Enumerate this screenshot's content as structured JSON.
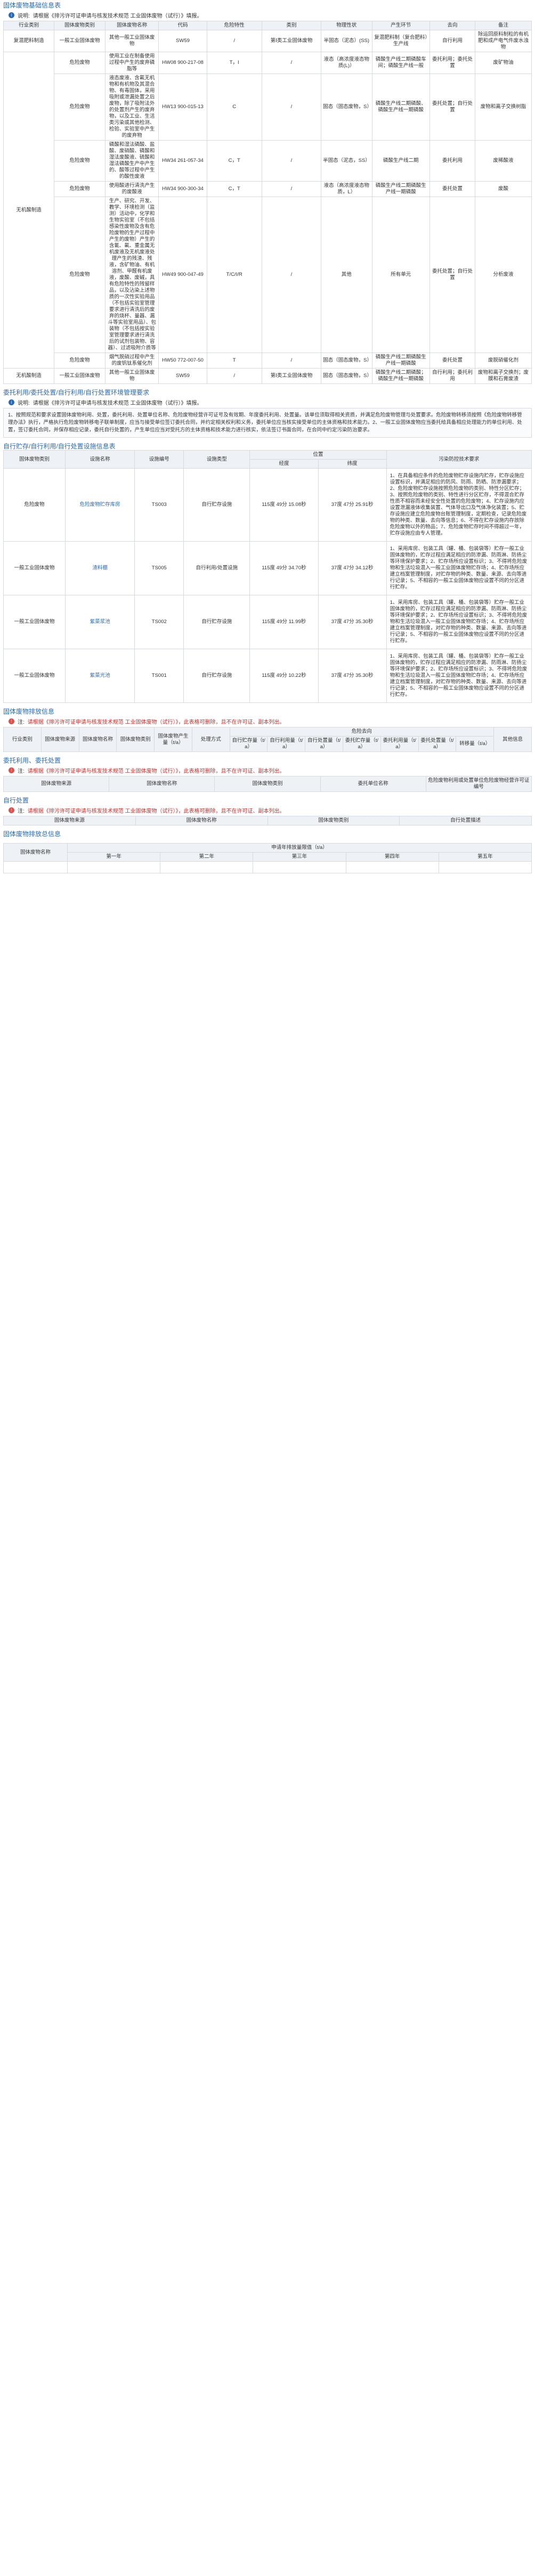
{
  "s1": {
    "title": "固体废物基础信息表",
    "note_label": "说明:",
    "note": "请根据《排污许可证申请与核发技术规范 工业固体废物（试行）》填报。",
    "headers": [
      "行业类别",
      "固体废物类别",
      "固体废物名称",
      "代码",
      "危险特性",
      "类别",
      "物理性状",
      "产生环节",
      "去向",
      "备注"
    ],
    "rows": [
      {
        "ind": "复混肥料制造",
        "type": "一般工业固体废物",
        "name": "其他一般工业固体废物",
        "code": "SW59",
        "hazard": "/",
        "cat": "第Ⅰ类工业固体废物",
        "phys": "半固态（泥态）(SS)",
        "stage": "复混肥料制（复合肥料）生产线",
        "dest": "自行利用",
        "remark": "除运回原料制粒的有机肥和成产电气件废水浊物"
      },
      {
        "ind": "",
        "type": "危险废物",
        "name": "使用工业在制备使用过程中产生的废弃磷脂等",
        "code": "HW08 900-217-08",
        "hazard": "T，I",
        "cat": "/",
        "phys": "液态（高浓度液态物质(L)）",
        "stage": "磷酸生产线二期磷酸车间；磷酸生产线一般",
        "dest": "委托利用；委托处置",
        "remark": "废矿物油"
      },
      {
        "ind": "",
        "type": "危险废物",
        "name": "液态废液、含氟无机物和有机物及其混合物、有毒固体，采用吸附或泄漏处置之后废物，除了吸附法外的处置剂产生的废弃物，以及工业、生活类污染或其他检测、检验、实验室中产生的废弃物",
        "code": "HW13 900-015-13",
        "hazard": "C",
        "cat": "/",
        "phys": "固态（固态废物，S）",
        "stage": "磷酸生产线二期磷酸、磷酸生产线一期磷酸",
        "dest": "委托处置；自行处置",
        "remark": "废物和离子交换树脂"
      },
      {
        "ind": "",
        "type": "危险废物",
        "name": "磷酸和湿法磷酸、盐酸、废硝酸、磷酸和湿法废酸液、硫酸和湿法磷酸生产中产生的、酸等过程中产生的酸性废液",
        "code": "HW34 261-057-34",
        "hazard": "C，T",
        "cat": "/",
        "phys": "半固态（泥态，SS）",
        "stage": "磷酸生产线二期",
        "dest": "委托利用",
        "remark": "废稀酸液"
      },
      {
        "ind": "",
        "type": "危险废物",
        "name": "使用酸进行清洗产生的废酸液",
        "code": "HW34 900-300-34",
        "hazard": "C，T",
        "cat": "/",
        "phys": "液态（高浓度液态物质，L）",
        "stage": "磷酸生产线二期磷酸生产线一期磷酸",
        "dest": "委托处置",
        "remark": "废酸"
      },
      {
        "ind": "无机酸制造",
        "type": "危险废物",
        "name": "生产、研究、开发、教学、环境检测（监测）活动中，化学和生物实验室（不包括感染性废物及含有危险废物的生产过程中产生的废物）产生的含氰、氟、重金属无机废液及无机废液处理产生的残渣、残液，含矿物油、有机溶剂、甲醛有机废液，废酸、废碱，具有危险特性的残留样品，以及沾染上述物质的一次性实验用品（不包括实验室管理要求进行清洗后的废弃的烧杯、量器、漏斗等实验室用品）、包装物（不包括按实验室管理要求进行清洗后的试剂包装物、容器）、过滤吸附介质等",
        "code": "HW49 900-047-49",
        "hazard": "T/C/I/R",
        "cat": "/",
        "phys": "其他",
        "stage": "所有单元",
        "dest": "委托处置；自行处置",
        "remark": "分析废液"
      },
      {
        "ind": "",
        "type": "危险废物",
        "name": "烟气脱硝过程中产生的废钒钛系催化剂",
        "code": "HW50 772-007-50",
        "hazard": "T",
        "cat": "/",
        "phys": "固态（固态废物，S）",
        "stage": "磷酸生产线二期磷酸生产线一期磷酸",
        "dest": "委托处置",
        "remark": "废脱硝催化剂"
      },
      {
        "ind": "无机酸制造",
        "type": "一般工业固体废物",
        "name": "其他一般工业固体废物",
        "code": "SW59",
        "hazard": "/",
        "cat": "第Ⅰ类工业固体废物",
        "phys": "固态（固态废物，S）",
        "stage": "磷酸生产线二期磷酸；磷酸生产线一期磷酸",
        "dest": "自行利用；委托利用",
        "remark": "废物和离子交换剂；废膜和石膏废渣"
      }
    ]
  },
  "s2": {
    "title": "委托利用/委托处置/自行利用/自行处置环境管理要求",
    "note_label": "说明:",
    "note": "请根据《排污许可证申请与核发技术规范 工业固体废物（试行）》填报。",
    "text": "1、按照规范和要求设置固体废物利用、处置，委托利用、处置单位名称、危险废物经营许可证号及有效期、年度委托利用、处置量。该单位须取得相关资质，并满足危险废物管理与处置要求。危险废物转移须按照《危险废物转移管理办法》执行，严格执行危险废物转移电子联单制度，应当与接受单位签订委托合同，并约定相关权利和义务，委托单位应当核实接受单位的主体资格和技术能力。2、一般工业固体废物应当委托给具备相应处理能力的单位利用、处置，签订委托合同，并保存相应记录，委托自行处置的，产生单位应当对受托方的主体资格和技术能力进行核实，依法签订书面合同，在合同中约定污染防治要求。"
  },
  "s3": {
    "title": "自行贮存/自行利用/自行处置设施信息表",
    "headers": [
      "固体废物类别",
      "设施名称",
      "设施编号",
      "设施类型",
      "位置",
      "经度",
      "纬度",
      "污染防控技术要求"
    ],
    "rows": [
      {
        "type": "危险废物",
        "name": "危险废物贮存库房",
        "no": "TS003",
        "kind": "自行贮存设施",
        "lng": "115度 49分 15.08秒",
        "lat": "37度 47分 25.91秒",
        "req": "1、在具备相应条件的危险废物贮存设施内贮存，贮存设施应设置标识，并满足相应的防风、防雨、防晒、防渗漏要求；2、危险废物贮存设施按照危险废物的类别、特性分区贮存；3、按照危险废物的类别、特性进行分区贮存，不得混合贮存性质不相容而未经安全性处置的危险废物；4、贮存设施内应设置泄漏液体收集装置、气体导出口及气体净化装置；5、贮存设施应建立危险废物台账管理制度，定期检查，记录危险废物的种类、数量、去向等信息；6、不得在贮存设施内存放除危险废物以外的物品；7、危险废物贮存时间不得超过一年，贮存设施应由专人管理。"
      },
      {
        "type": "一般工业固体废物",
        "name": "渣料棚",
        "no": "TS005",
        "kind": "自行利用/处置设施",
        "lng": "115度 49分 34.70秒",
        "lat": "37度 47分 34.12秒",
        "req": "1、采用库房、包装工具（罐、桶、包装袋等）贮存一般工业固体废物的，贮存过程应满足相应的防渗漏、防雨淋、防扬尘等环境保护要求；2、贮存场所应设置标识；3、不得将危险废物和生活垃圾混入一般工业固体废物贮存场；4、贮存场所应建立档案管理制度，对贮存物的种类、数量、来源、去向等进行记录；5、不相容的一般工业固体废物应设置不同的分区进行贮存。"
      },
      {
        "type": "一般工业固体废物",
        "name": "紫菜浆池",
        "no": "TS002",
        "kind": "自行贮存设施",
        "lng": "115度 49分 11.99秒",
        "lat": "37度 47分 35.30秒",
        "req": "1、采用库房、包装工具（罐、桶、包装袋等）贮存一般工业固体废物的，贮存过程应满足相应的防渗漏、防雨淋、防扬尘等环境保护要求；2、贮存场所应设置标识；3、不得将危险废物和生活垃圾混入一般工业固体废物贮存场；4、贮存场所应建立档案管理制度，对贮存物的种类、数量、来源、去向等进行记录；5、不相容的一般工业固体废物应设置不同的分区进行贮存。"
      },
      {
        "type": "一般工业固体废物",
        "name": "紫菜光池",
        "no": "TS001",
        "kind": "自行贮存设施",
        "lng": "115度 49分 10.22秒",
        "lat": "37度 47分 35.30秒",
        "req": "1、采用库房、包装工具（罐、桶、包装袋等）贮存一般工业固体废物的，贮存过程应满足相应的防渗漏、防雨淋、防扬尘等环境保护要求；2、贮存场所应设置标识；3、不得将危险废物和生活垃圾混入一般工业固体废物贮存场；4、贮存场所应建立档案管理制度，对贮存物的种类、数量、来源、去向等进行记录；5、不相容的一般工业固体废物应设置不同的分区进行贮存。"
      }
    ]
  },
  "s4": {
    "title": "固体废物排放信息",
    "note_label": "注:",
    "note": "请根据《排污许可证申请与核发技术规范 工业固体废物（试行）》，此表格可删除，且不在许可证、副本列出。",
    "h_top": "危险去向",
    "headers": [
      "行业类别",
      "固体废物来源",
      "固体废物名称",
      "固体废物类别",
      "固体废物产生量（t/a）",
      "处理方式",
      "自行贮存量（t/a）",
      "自行利用量（t/a）",
      "自行处置量（t/a）",
      "委托贮存量（t/a）",
      "委托利用量（t/a）",
      "委托处置量（t/a）",
      "转移量（t/a）",
      "其他信息"
    ]
  },
  "s5": {
    "title": "委托利用、委托处置",
    "note_label": "注:",
    "note": "请根据《排污许可证申请与核发技术规范 工业固体废物（试行）》，此表格可删除，且不在许可证、副本列出。",
    "headers": [
      "固体废物来源",
      "固体废物名称",
      "固体废物类别",
      "委托单位名称",
      "危险废物利用或处置单位危险废物经营许可证编号"
    ]
  },
  "s6": {
    "title": "自行处置",
    "note_label": "注:",
    "note": "请根据《排污许可证申请与核发技术规范 工业固体废物（试行）》，此表格可删除，且不在许可证、副本列出。",
    "headers": [
      "固体废物来源",
      "固体废物名称",
      "固体废物类别",
      "自行处置描述"
    ]
  },
  "s7": {
    "title": "固体废物排放总信息",
    "h_unit": "固体废物名称",
    "h_group": "申请年排放量限值（t/a）",
    "years": [
      "第一年",
      "第二年",
      "第三年",
      "第四年",
      "第五年"
    ]
  }
}
